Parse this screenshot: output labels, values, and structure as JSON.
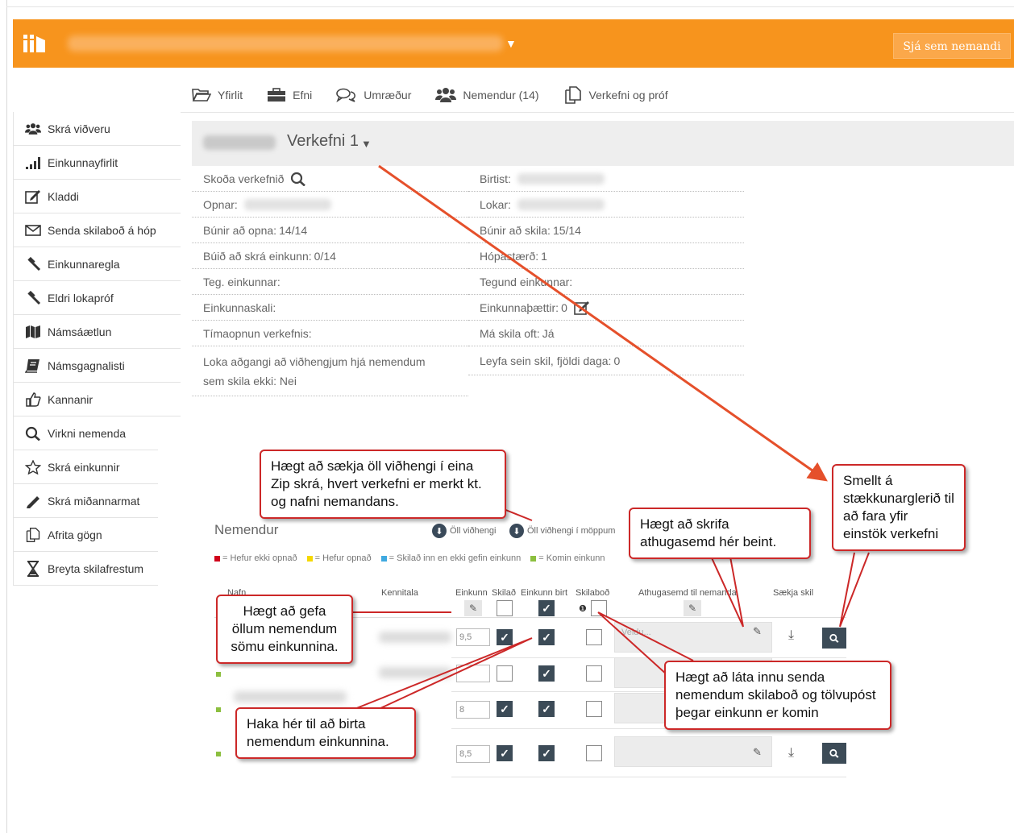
{
  "header": {
    "student_view_button": "Sjá sem nemandi",
    "brand_color": "#f7941d"
  },
  "tabs": [
    {
      "label": "Yfirlit",
      "icon": "folder-open-icon"
    },
    {
      "label": "Efni",
      "icon": "briefcase-icon"
    },
    {
      "label": "Umræður",
      "icon": "comments-icon"
    },
    {
      "label": "Nemendur (14)",
      "icon": "users-icon"
    },
    {
      "label": "Verkefni og próf",
      "icon": "copy-icon"
    }
  ],
  "sidebar": {
    "items": [
      {
        "label": "Skrá viðveru",
        "icon": "users-icon"
      },
      {
        "label": "Einkunnayfirlit",
        "icon": "signal-bars-icon"
      },
      {
        "label": "Kladdi",
        "icon": "edit-icon"
      },
      {
        "label": "Senda skilaboð á hóp",
        "icon": "envelope-icon"
      },
      {
        "label": "Einkunnaregla",
        "icon": "gavel-icon"
      },
      {
        "label": "Eldri lokapróf",
        "icon": "gavel-icon"
      },
      {
        "label": "Námsáætlun",
        "icon": "map-icon"
      },
      {
        "label": "Námsgagnalisti",
        "icon": "book-icon"
      },
      {
        "label": "Kannanir",
        "icon": "thumbs-up-icon"
      },
      {
        "label": "Virkni nemenda",
        "icon": "search-icon"
      },
      {
        "label": "Skrá einkunnir",
        "icon": "star-icon"
      },
      {
        "label": "Skrá miðannarmat",
        "icon": "pencil-icon"
      },
      {
        "label": "Afrita gögn",
        "icon": "copy-icon"
      },
      {
        "label": "Breyta skilafrestum",
        "icon": "hourglass-icon"
      }
    ]
  },
  "assignment": {
    "title": "Verkefni 1"
  },
  "info": {
    "left": [
      {
        "label": "Skoða verkefnið",
        "value": ""
      },
      {
        "label": "Opnar:",
        "value": ""
      },
      {
        "label": "Búnir að opna:",
        "value": "14/14"
      },
      {
        "label": "Búið að skrá einkunn:",
        "value": "0/14"
      },
      {
        "label": "Teg. einkunnar:",
        "value": ""
      },
      {
        "label": "Einkunnaskali:",
        "value": ""
      },
      {
        "label": "Tímaopnun verkefnis:",
        "value": ""
      }
    ],
    "left_last_line1": "Loka aðgangi að viðhengjum hjá nemendum",
    "left_last_line2": "sem skila ekki:",
    "left_last_value": "Nei",
    "right": [
      {
        "label": "Birtist:",
        "value": ""
      },
      {
        "label": "Lokar:",
        "value": ""
      },
      {
        "label": "Búnir að skila:",
        "value": "15/14"
      },
      {
        "label": "Hópastærð:",
        "value": "1"
      },
      {
        "label": "Tegund einkunnar:",
        "value": ""
      },
      {
        "label": "Einkunnaþættir:",
        "value": "0"
      },
      {
        "label": "Má skila oft:",
        "value": "Já"
      },
      {
        "label": "Leyfa sein skil, fjöldi daga:",
        "value": "0"
      }
    ]
  },
  "students": {
    "title": "Nemendur",
    "download_all": "Öll viðhengi",
    "download_folders": "Öll viðhengi í möppum",
    "legend": [
      {
        "label": "= Hefur ekki opnað",
        "color": "#d0021b"
      },
      {
        "label": "= Hefur opnað",
        "color": "#f5d800"
      },
      {
        "label": "= Skilað inn en ekki gefin einkunn",
        "color": "#3fa9e0"
      },
      {
        "label": "= Komin einkunn",
        "color": "#8cbf3f"
      }
    ],
    "columns": {
      "name": "Nafn",
      "ssn": "Kennitala",
      "grade": "Einkunn",
      "submitted": "Skilað",
      "grade_published": "Einkunn birt",
      "message": "Skilaboð",
      "comment": "Athugasemd til nemanda",
      "fetch": "Sækja skil"
    },
    "rows": [
      {
        "grade": "9,5",
        "submitted": true,
        "published": true,
        "message": false,
        "comment_placeholder": "Veldu..."
      },
      {
        "grade": "",
        "submitted": false,
        "published": true,
        "message": false,
        "comment_placeholder": ""
      },
      {
        "grade": "8",
        "submitted": true,
        "published": true,
        "message": false,
        "comment_placeholder": ""
      },
      {
        "grade": "8,5",
        "submitted": true,
        "published": true,
        "message": false,
        "comment_placeholder": ""
      }
    ]
  },
  "callouts": {
    "zip": "Hægt að sækja öll viðhengi í eina Zip skrá, hvert verkefni er merkt kt. og nafni nemandans.",
    "comment": "Hægt að skrifa athugasemd hér beint.",
    "magnifier": "Smellt á stækkunarglerið til að fara yfir einstök verkefni",
    "same_grade": "Hægt að gefa öllum nemendum sömu einkunnina.",
    "publish": "Haka hér til að birta nemendum einkunnina.",
    "message": "Hægt að láta innu senda nemendum skilaboð og tölvupóst þegar einkunn er komin"
  }
}
